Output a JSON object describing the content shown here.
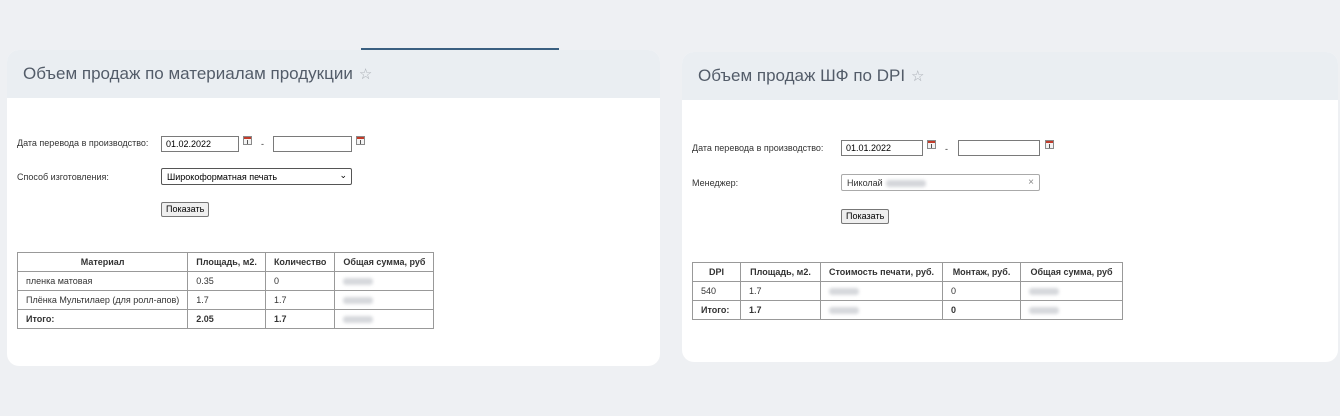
{
  "left_panel": {
    "title": "Объем продаж по материалам продукции",
    "date_label": "Дата перевода в производство:",
    "date_from": "01.02.2022",
    "date_to": "",
    "date_separator": "-",
    "method_label": "Способ изготовления:",
    "method_value": "Широкоформатная печать",
    "show_button": "Показать",
    "table": {
      "headers": [
        "Материал",
        "Площадь, м2.",
        "Количество",
        "Общая сумма, руб"
      ],
      "rows": [
        {
          "material": "пленка матовая",
          "area": "0.35",
          "qty": "0"
        },
        {
          "material": "Плёнка Мультилаер (для ролл-апов)",
          "area": "1.7",
          "qty": "1.7"
        }
      ],
      "total": {
        "label": "Итого:",
        "area": "2.05",
        "qty": "1.7"
      }
    }
  },
  "right_panel": {
    "title": "Объем продаж ШФ по DPI",
    "date_label": "Дата перевода в производство:",
    "date_from": "01.01.2022",
    "date_to": "",
    "date_separator": "-",
    "manager_label": "Менеджер:",
    "manager_value": "Николай",
    "show_button": "Показать",
    "table": {
      "headers": [
        "DPI",
        "Площадь, м2.",
        "Стоимость печати, руб.",
        "Монтаж, руб.",
        "Общая сумма, руб"
      ],
      "rows": [
        {
          "dpi": "540",
          "area": "1.7",
          "mount": "0"
        }
      ],
      "total": {
        "label": "Итого:",
        "area": "1.7",
        "mount": "0"
      }
    }
  },
  "icons": {
    "star": "star-icon",
    "calendar": "calendar-icon",
    "chevron": "chevron-down-icon",
    "clear": "close-icon"
  }
}
